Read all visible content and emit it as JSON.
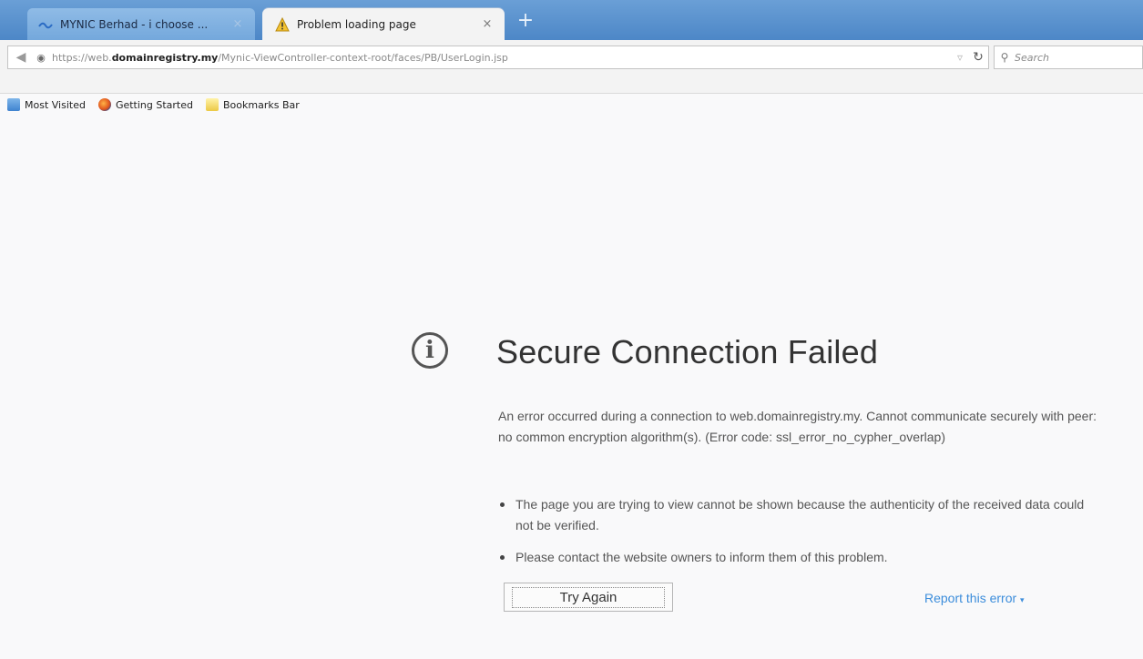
{
  "tabs": [
    {
      "title": "MYNIC Berhad - i choose ...",
      "close": "×",
      "favicon": "mynic-icon"
    },
    {
      "title": "Problem loading page",
      "close": "×",
      "favicon": "warning-icon",
      "active": true
    }
  ],
  "newtab": "+",
  "navbar": {
    "url_prefix": "https://web.",
    "url_domain": "domainregistry.my",
    "url_path": "/Mynic-ViewController-context-root/faces/PB/UserLogin.jsp",
    "search_placeholder": "Search"
  },
  "bookmarks": [
    "Most Visited",
    "Getting Started",
    "Bookmarks Bar"
  ],
  "error": {
    "title": "Secure Connection Failed",
    "description": "An error occurred during a connection to web.domainregistry.my. Cannot communicate securely with peer: no common encryption algorithm(s). (Error code: ssl_error_no_cypher_overlap)",
    "bullets": [
      "The page you are trying to view cannot be shown because the authenticity of the received data could not be verified.",
      "Please contact the website owners to inform them of this problem."
    ],
    "try_again": "Try Again",
    "report": "Report this error"
  },
  "colors": {
    "tabstrip": "#4d87c7",
    "link": "#3c8ddb",
    "page_bg": "#f9f9fa"
  }
}
